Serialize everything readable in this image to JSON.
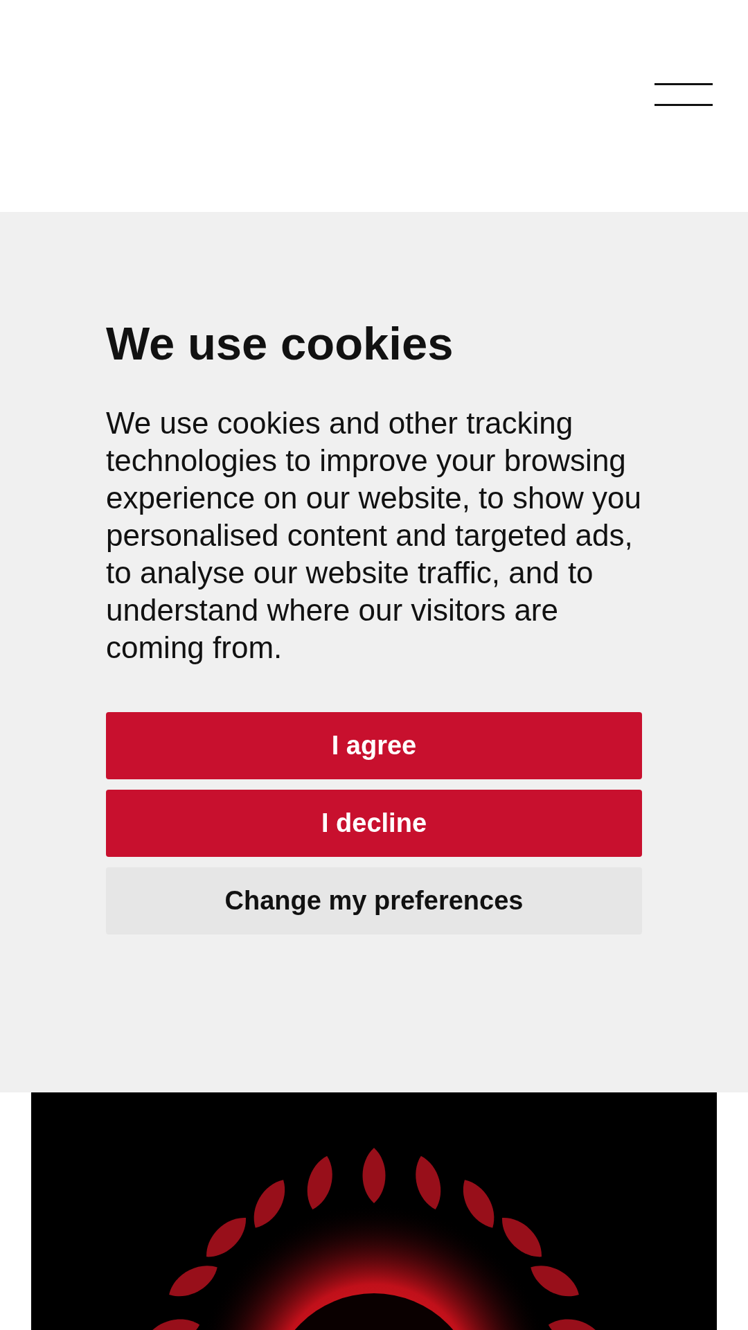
{
  "cookie_banner": {
    "title": "We use cookies",
    "message": "We use cookies and other tracking technologies to improve your browsing experience on our website, to show you personalised content and targeted ads, to analyse our website traffic, and to understand where our visitors are coming from.",
    "buttons": [
      {
        "label": "I agree",
        "kind": "primary"
      },
      {
        "label": "I decline",
        "kind": "primary"
      },
      {
        "label": "Change my preferences",
        "kind": "secondary"
      }
    ]
  }
}
